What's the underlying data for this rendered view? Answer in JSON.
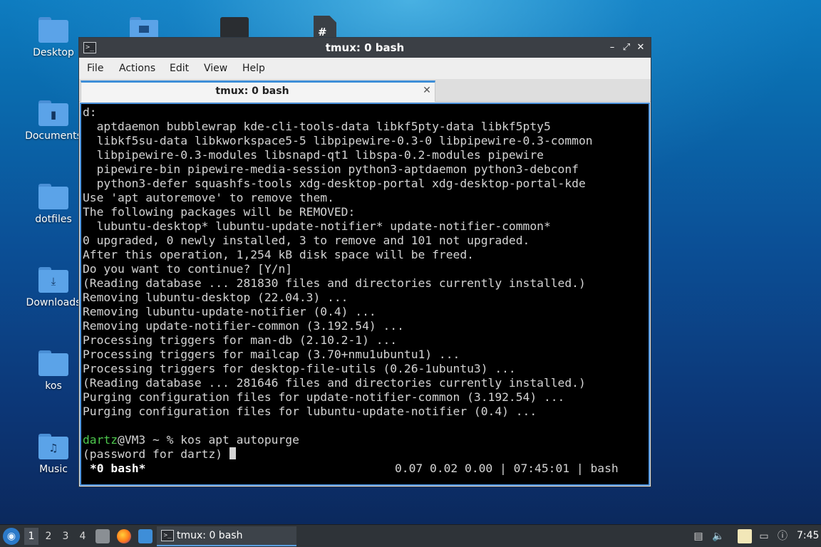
{
  "desktop": {
    "icons": [
      {
        "label": "Desktop",
        "icon": "folder-icon",
        "glyph": ""
      },
      {
        "label": "Documents",
        "icon": "folder-documents-icon",
        "glyph": "▮"
      },
      {
        "label": "dotfiles",
        "icon": "folder-icon",
        "glyph": ""
      },
      {
        "label": "Downloads",
        "icon": "folder-downloads-icon",
        "glyph": "⤓"
      },
      {
        "label": "kos",
        "icon": "folder-icon",
        "glyph": ""
      },
      {
        "label": "Music",
        "icon": "folder-music-icon",
        "glyph": "♫"
      }
    ]
  },
  "window": {
    "title": "tmux: 0 bash",
    "app_icon_text": ">_",
    "controls": {
      "minimize": "–",
      "maximize": "⤢",
      "close": "✕"
    },
    "menu": [
      "File",
      "Actions",
      "Edit",
      "View",
      "Help"
    ],
    "tab": {
      "title": "tmux: 0 bash",
      "close": "✕"
    }
  },
  "terminal": {
    "lines": [
      "d:",
      "  aptdaemon bubblewrap kde-cli-tools-data libkf5pty-data libkf5pty5",
      "  libkf5su-data libkworkspace5-5 libpipewire-0.3-0 libpipewire-0.3-common",
      "  libpipewire-0.3-modules libsnapd-qt1 libspa-0.2-modules pipewire",
      "  pipewire-bin pipewire-media-session python3-aptdaemon python3-debconf",
      "  python3-defer squashfs-tools xdg-desktop-portal xdg-desktop-portal-kde",
      "Use 'apt autoremove' to remove them.",
      "The following packages will be REMOVED:",
      "  lubuntu-desktop* lubuntu-update-notifier* update-notifier-common*",
      "0 upgraded, 0 newly installed, 3 to remove and 101 not upgraded.",
      "After this operation, 1,254 kB disk space will be freed.",
      "Do you want to continue? [Y/n]",
      "(Reading database ... 281830 files and directories currently installed.)",
      "Removing lubuntu-desktop (22.04.3) ...",
      "Removing lubuntu-update-notifier (0.4) ...",
      "Removing update-notifier-common (3.192.54) ...",
      "Processing triggers for man-db (2.10.2-1) ...",
      "Processing triggers for mailcap (3.70+nmu1ubuntu1) ...",
      "Processing triggers for desktop-file-utils (0.26-1ubuntu3) ...",
      "(Reading database ... 281646 files and directories currently installed.)",
      "Purging configuration files for update-notifier-common (3.192.54) ...",
      "Purging configuration files for lubuntu-update-notifier (0.4) ...",
      ""
    ],
    "prompt": {
      "user": "dartz",
      "rest": "@VM3 ~ % kos apt autopurge"
    },
    "password_line": "(password for dartz) ",
    "status_left": "*0 bash*",
    "status_right": "0.07 0.02 0.00 | 07:45:01 | bash"
  },
  "taskbar": {
    "start_icon": "lubuntu-logo-icon",
    "desktops": [
      "1",
      "2",
      "3",
      "4"
    ],
    "active_desktop": "1",
    "quick_launch": [
      "file-manager-icon",
      "firefox-icon",
      "show-desktop-icon"
    ],
    "task": {
      "label": "tmux: 0 bash"
    },
    "tray": [
      "notes-icon",
      "volume-icon",
      "clipboard-icon",
      "network-icon",
      "update-notifier-icon"
    ],
    "clock": "7:45"
  }
}
